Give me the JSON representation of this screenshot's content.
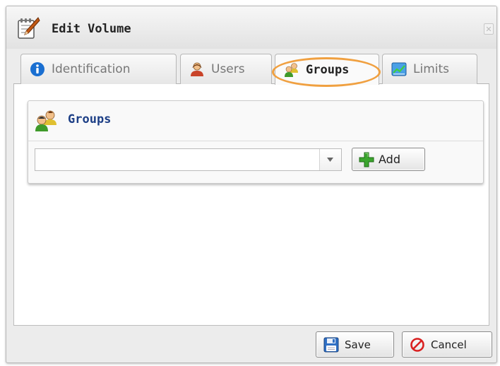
{
  "dialog": {
    "title": "Edit Volume",
    "title_icon": "edit-notepad-icon",
    "close_icon": "close-icon"
  },
  "tabs": [
    {
      "label": "Identification",
      "icon": "info-icon",
      "active": false
    },
    {
      "label": "Users",
      "icon": "user-icon",
      "active": false
    },
    {
      "label": "Groups",
      "icon": "groups-icon",
      "active": true
    },
    {
      "label": "Limits",
      "icon": "limits-chart-icon",
      "active": false
    }
  ],
  "groups_panel": {
    "title": "Groups",
    "icon": "groups-icon",
    "select_value": "",
    "dropdown_icon": "dropdown-arrow-icon",
    "add_label": "Add",
    "add_icon": "plus-icon"
  },
  "footer": {
    "save_label": "Save",
    "save_icon": "floppy-disk-icon",
    "cancel_label": "Cancel",
    "cancel_icon": "cancel-icon"
  },
  "colors": {
    "highlight": "#f0a040",
    "panel_title": "#1d3f86",
    "info_blue": "#1a6fd1",
    "add_green": "#3ba52e",
    "cancel_red": "#d92020"
  }
}
